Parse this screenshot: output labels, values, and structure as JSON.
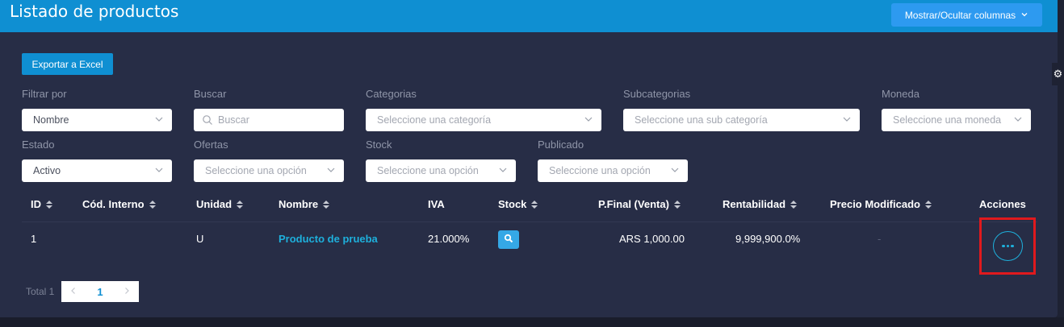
{
  "header": {
    "title": "Listado de productos",
    "columns_button": "Mostrar/Ocultar columnas"
  },
  "toolbar": {
    "export_label": "Exportar a Excel"
  },
  "filters": {
    "filter_by": {
      "label": "Filtrar por",
      "value": "Nombre"
    },
    "search": {
      "label": "Buscar",
      "placeholder": "Buscar"
    },
    "categories": {
      "label": "Categorias",
      "placeholder": "Seleccione una categoría"
    },
    "subcategories": {
      "label": "Subcategorias",
      "placeholder": "Seleccione una sub categoría"
    },
    "currency": {
      "label": "Moneda",
      "placeholder": "Seleccione una moneda"
    },
    "state": {
      "label": "Estado",
      "value": "Activo"
    },
    "offers": {
      "label": "Ofertas",
      "placeholder": "Seleccione una opción"
    },
    "stock": {
      "label": "Stock",
      "placeholder": "Seleccione una opción"
    },
    "published": {
      "label": "Publicado",
      "placeholder": "Seleccione una opción"
    }
  },
  "table": {
    "columns": [
      "ID",
      "Cód. Interno",
      "Unidad",
      "Nombre",
      "IVA",
      "Stock",
      "P.Final (Venta)",
      "Rentabilidad",
      "Precio Modificado",
      "Acciones"
    ],
    "rows": [
      {
        "id": "1",
        "internal_code": "",
        "unit": "U",
        "name": "Producto de prueba",
        "iva": "21.000%",
        "final_price": "ARS 1,000.00",
        "profitability": "9,999,900.0%",
        "modified_price": "-"
      }
    ]
  },
  "pagination": {
    "total_label": "Total 1",
    "current_page": "1"
  },
  "colors": {
    "header": "#0f8fd2",
    "panel": "#272d46",
    "accent": "#1eb0dc",
    "highlight": "#e0191d"
  },
  "icons": [
    "chevron-down-icon",
    "search-icon",
    "gear-icon",
    "sort-icon",
    "more-horizontal-icon",
    "chevron-left-icon",
    "chevron-right-icon"
  ]
}
